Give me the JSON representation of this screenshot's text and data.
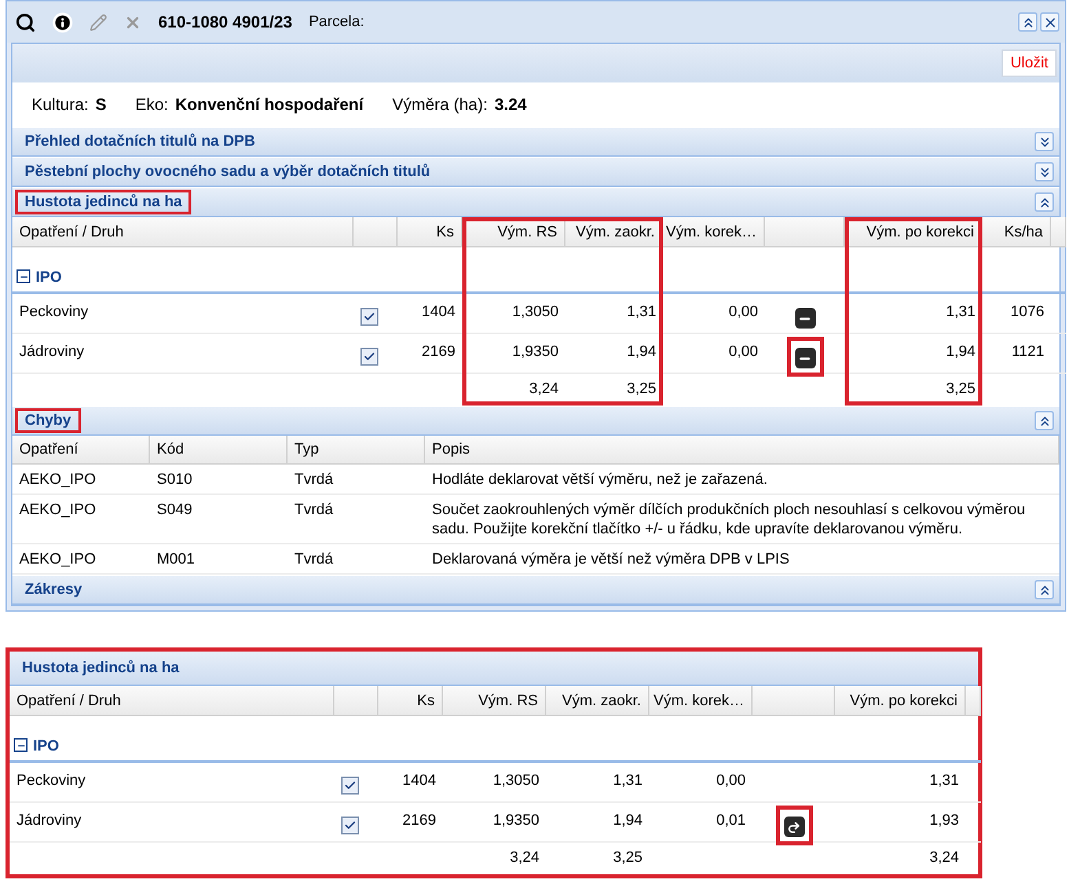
{
  "toolbar": {
    "parcel_code": "610-1080 4901/23",
    "parcel_label": "Parcela:"
  },
  "save_button": "Uložit",
  "info": [
    {
      "label": "Kultura:",
      "value": "S"
    },
    {
      "label": "Eko:",
      "value": "Konvenční hospodaření"
    },
    {
      "label": "Výměra (ha):",
      "value": "3.24"
    }
  ],
  "panels": [
    {
      "title": "Přehled dotačních titulů na DPB",
      "expanded": false,
      "highlighted": false
    },
    {
      "title": "Pěstební plochy ovocného sadu a výběr dotačních titulů",
      "expanded": false,
      "highlighted": false
    },
    {
      "title": "Hustota jedinců na ha",
      "expanded": true,
      "highlighted": true,
      "kind": "grid",
      "grid": {
        "columns": [
          {
            "kind": "druh",
            "label": "Opatření / Druh",
            "highlighted": false
          },
          {
            "kind": "check",
            "highlighted": false
          },
          {
            "kind": "ks",
            "label": "Ks",
            "highlighted": false
          },
          {
            "kind": "vym_rs",
            "label": "Vým. RS",
            "highlighted": true
          },
          {
            "kind": "vym_zaokr",
            "label": "Vým. zaokr.",
            "highlighted": true
          },
          {
            "kind": "vym_korekce",
            "label": "Vým. korek…",
            "highlighted": false
          },
          {
            "kind": "action",
            "highlighted": false
          },
          {
            "kind": "vym_po_korekci",
            "label": "Vým. po korekci",
            "highlighted": true
          },
          {
            "kind": "ks_ha",
            "label": "Ks/ha",
            "highlighted": false
          }
        ],
        "group": "IPO",
        "group_expanded": true,
        "rows": [
          {
            "druh": "Peckoviny",
            "checked": true,
            "ks": "1404",
            "vym_rs": "1,3050",
            "vym_zaokr": "1,31",
            "vym_korekce": "0,00",
            "action": {
              "kind": "minus",
              "highlighted": false
            },
            "vym_po_korekci": "1,31",
            "ks_ha": "1076"
          },
          {
            "druh": "Jádroviny",
            "checked": true,
            "ks": "2169",
            "vym_rs": "1,9350",
            "vym_zaokr": "1,94",
            "vym_korekce": "0,00",
            "action": {
              "kind": "minus",
              "highlighted": true
            },
            "vym_po_korekci": "1,94",
            "ks_ha": "1121"
          }
        ],
        "totals": {
          "vym_rs": "3,24",
          "vym_zaokr": "3,25",
          "vym_po_korekci": "3,25"
        }
      }
    },
    {
      "title": "Chyby",
      "expanded": true,
      "highlighted": true,
      "kind": "errors",
      "errors": {
        "columns": [
          "Opatření",
          "Kód",
          "Typ",
          "Popis"
        ],
        "rows": [
          [
            "AEKO_IPO",
            "S010",
            "Tvrdá",
            "Hodláte deklarovat větší výměru, než je zařazená."
          ],
          [
            "AEKO_IPO",
            "S049",
            "Tvrdá",
            "Součet zaokrouhlených výměr dílčích produkčních ploch nesouhlasí s celkovou výměrou sadu. Použijte korekční tlačítko +/- u řádku, kde upravíte deklarovanou výměru."
          ],
          [
            "AEKO_IPO",
            "M001",
            "Tvrdá",
            "Deklarovaná výměra je větší než výměra DPB v LPIS"
          ]
        ]
      }
    },
    {
      "title": "Zákresy",
      "expanded": true,
      "highlighted": false
    }
  ],
  "detail_panel": {
    "title": "Hustota jedinců na ha",
    "highlighted": true,
    "grid": {
      "columns": [
        {
          "kind": "druh",
          "label": "Opatření / Druh",
          "highlighted": false
        },
        {
          "kind": "check",
          "highlighted": false
        },
        {
          "kind": "ks",
          "label": "Ks",
          "highlighted": false
        },
        {
          "kind": "vym_rs",
          "label": "Vým. RS",
          "highlighted": false
        },
        {
          "kind": "vym_zaokr",
          "label": "Vým. zaokr.",
          "highlighted": false
        },
        {
          "kind": "vym_korekce",
          "label": "Vým. korek…",
          "highlighted": false
        },
        {
          "kind": "action",
          "highlighted": false
        },
        {
          "kind": "vym_po_korekci",
          "label": "Vým. po korekci",
          "highlighted": false
        }
      ],
      "group": "IPO",
      "group_expanded": true,
      "rows": [
        {
          "druh": "Peckoviny",
          "checked": true,
          "ks": "1404",
          "vym_rs": "1,3050",
          "vym_zaokr": "1,31",
          "vym_korekce": "0,00",
          "action": null,
          "vym_po_korekci": "1,31"
        },
        {
          "druh": "Jádroviny",
          "checked": true,
          "ks": "2169",
          "vym_rs": "1,9350",
          "vym_zaokr": "1,94",
          "vym_korekce": "0,01",
          "action": {
            "kind": "redo",
            "highlighted": true
          },
          "vym_po_korekci": "1,93"
        }
      ],
      "totals": {
        "vym_rs": "3,24",
        "vym_zaokr": "3,25",
        "vym_po_korekci": "3,24"
      }
    }
  }
}
